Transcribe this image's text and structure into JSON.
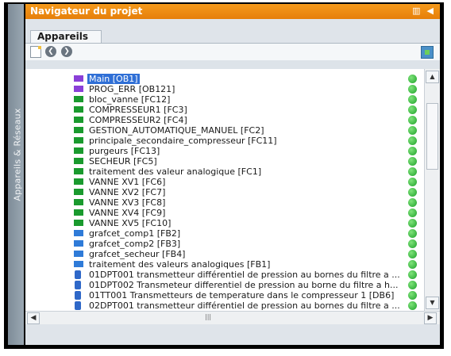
{
  "sidebar": {
    "label": "Appareils & Réseaux"
  },
  "header": {
    "title": "Navigateur du projet"
  },
  "tabs": [
    {
      "label": "Appareils"
    }
  ],
  "toolbar": {
    "back_icon": "back-icon",
    "forward_icon": "forward-icon",
    "new_icon": "new-item-icon",
    "network_icon": "network-view-icon"
  },
  "colors": {
    "accent": "#f0901a",
    "selection": "#2f6fd6",
    "status_ok": "#22a82d"
  },
  "blocks": [
    {
      "label": "Main [OB1]",
      "icon": "ob-block-icon",
      "color": "purple",
      "selected": true
    },
    {
      "label": "PROG_ERR [OB121]",
      "icon": "ob-block-icon",
      "color": "purple"
    },
    {
      "label": "bloc_vanne [FC12]",
      "icon": "fc-block-icon",
      "color": "green"
    },
    {
      "label": "COMPRESSEUR1 [FC3]",
      "icon": "fc-block-icon",
      "color": "green"
    },
    {
      "label": "COMPRESSEUR2 [FC4]",
      "icon": "fc-block-icon",
      "color": "green"
    },
    {
      "label": "GESTION_AUTOMATIQUE_MANUEL [FC2]",
      "icon": "fc-block-icon",
      "color": "green"
    },
    {
      "label": "principale_secondaire_compresseur [FC11]",
      "icon": "fc-block-icon",
      "color": "green"
    },
    {
      "label": "purgeurs [FC13]",
      "icon": "fc-block-icon",
      "color": "green"
    },
    {
      "label": "SECHEUR [FC5]",
      "icon": "fc-block-icon",
      "color": "green"
    },
    {
      "label": "traitement des valeur analogique [FC1]",
      "icon": "fc-block-icon",
      "color": "green"
    },
    {
      "label": "VANNE XV1 [FC6]",
      "icon": "fc-block-icon",
      "color": "green"
    },
    {
      "label": "VANNE XV2 [FC7]",
      "icon": "fc-block-icon",
      "color": "green"
    },
    {
      "label": "VANNE XV3 [FC8]",
      "icon": "fc-block-icon",
      "color": "green"
    },
    {
      "label": "VANNE XV4 [FC9]",
      "icon": "fc-block-icon",
      "color": "green"
    },
    {
      "label": "VANNE XV5 [FC10]",
      "icon": "fc-block-icon",
      "color": "green"
    },
    {
      "label": "grafcet_comp1 [FB2]",
      "icon": "fb-block-icon",
      "color": "blue"
    },
    {
      "label": "grafcet_comp2 [FB3]",
      "icon": "fb-block-icon",
      "color": "blue"
    },
    {
      "label": "grafcet_secheur [FB4]",
      "icon": "fb-block-icon",
      "color": "blue"
    },
    {
      "label": "traitement des valeurs analogiques [FB1]",
      "icon": "fb-block-icon",
      "color": "blue"
    },
    {
      "label": "01DPT001 transmetteur différentiel de pression au bornes du filtre a ...",
      "icon": "db-block-icon",
      "color": "db"
    },
    {
      "label": "01DPT002 Transmeteur differentiel de pression au borne du filtre a h...",
      "icon": "db-block-icon",
      "color": "db"
    },
    {
      "label": "01TT001 Transmetteurs de temperature dans le compresseur 1 [DB6]",
      "icon": "db-block-icon",
      "color": "db"
    },
    {
      "label": "02DPT001 transmetteur différentiel de pression au bornes du filtre a ...",
      "icon": "db-block-icon",
      "color": "db"
    }
  ]
}
